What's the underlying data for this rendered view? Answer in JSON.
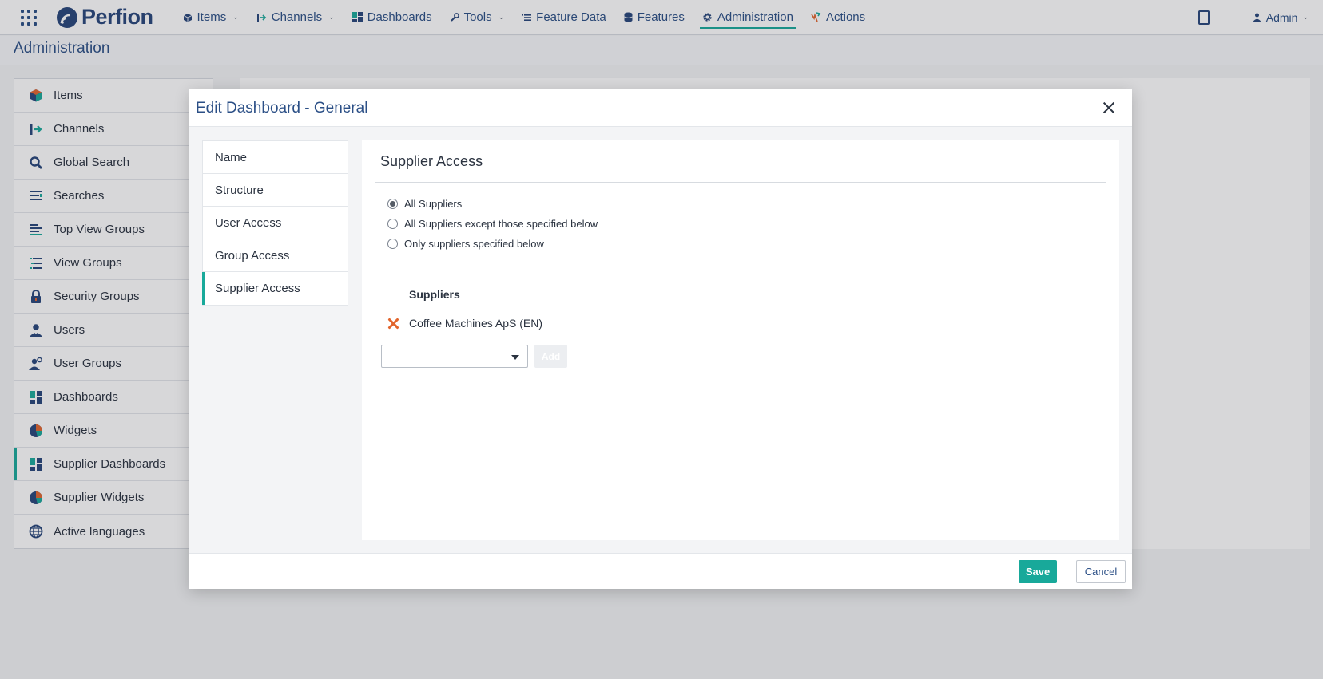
{
  "app": {
    "brand": "Perfion"
  },
  "topnav": {
    "items": [
      {
        "label": "Items",
        "icon": "box-icon",
        "has_caret": true
      },
      {
        "label": "Channels",
        "icon": "channels-icon",
        "has_caret": true
      },
      {
        "label": "Dashboards",
        "icon": "dashboard-icon",
        "has_caret": false
      },
      {
        "label": "Tools",
        "icon": "wrench-icon",
        "has_caret": true
      },
      {
        "label": "Feature Data",
        "icon": "feature-data-icon",
        "has_caret": false
      },
      {
        "label": "Features",
        "icon": "database-icon",
        "has_caret": false
      },
      {
        "label": "Administration",
        "icon": "gear-icon",
        "has_caret": false,
        "active": true
      },
      {
        "label": "Actions",
        "icon": "actions-icon",
        "has_caret": false
      }
    ],
    "user_label": "Admin"
  },
  "page": {
    "title": "Administration"
  },
  "sidebar": {
    "items": [
      {
        "label": "Items",
        "icon": "box-icon"
      },
      {
        "label": "Channels",
        "icon": "channels-icon"
      },
      {
        "label": "Global Search",
        "icon": "search-icon"
      },
      {
        "label": "Searches",
        "icon": "searches-icon"
      },
      {
        "label": "Top View Groups",
        "icon": "top-view-groups-icon"
      },
      {
        "label": "View Groups",
        "icon": "view-groups-icon"
      },
      {
        "label": "Security Groups",
        "icon": "lock-icon"
      },
      {
        "label": "Users",
        "icon": "user-icon"
      },
      {
        "label": "User Groups",
        "icon": "user-group-icon"
      },
      {
        "label": "Dashboards",
        "icon": "dashboard-icon"
      },
      {
        "label": "Widgets",
        "icon": "pie-chart-icon"
      },
      {
        "label": "Supplier Dashboards",
        "icon": "dashboard-icon",
        "active": true
      },
      {
        "label": "Supplier Widgets",
        "icon": "pie-chart-icon"
      },
      {
        "label": "Active languages",
        "icon": "globe-icon"
      }
    ]
  },
  "modal": {
    "title": "Edit Dashboard - General",
    "tabs": [
      {
        "label": "Name"
      },
      {
        "label": "Structure"
      },
      {
        "label": "User Access"
      },
      {
        "label": "Group Access"
      },
      {
        "label": "Supplier Access",
        "active": true
      }
    ],
    "panel": {
      "title": "Supplier Access",
      "options": [
        {
          "label": "All Suppliers",
          "checked": true
        },
        {
          "label": "All Suppliers except those specified below",
          "checked": false
        },
        {
          "label": "Only suppliers specified below",
          "checked": false
        }
      ],
      "suppliers_heading": "Suppliers",
      "suppliers": [
        "Coffee Machines ApS (EN)"
      ],
      "select_value": "",
      "add_label": "Add"
    },
    "save_label": "Save",
    "cancel_label": "Cancel"
  },
  "colors": {
    "accent": "#18a99a",
    "brand": "#27457a",
    "remove": "#e2662e"
  }
}
